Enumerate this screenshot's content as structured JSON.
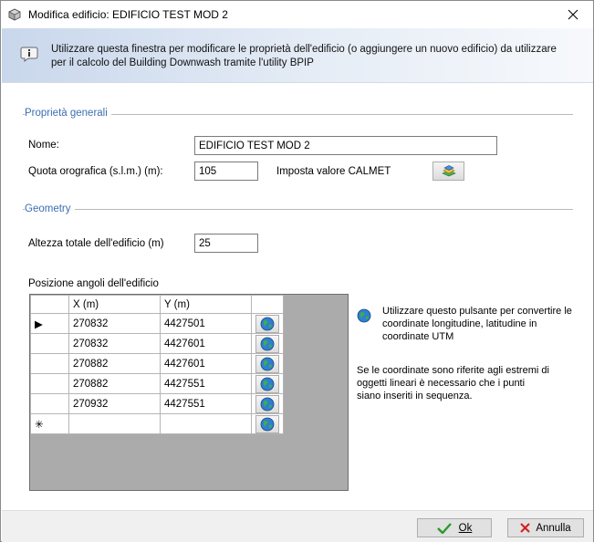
{
  "window": {
    "title": "Modifica edificio: EDIFICIO TEST MOD 2"
  },
  "info": {
    "text": "Utilizzare questa finestra per modificare le proprietà dell'edificio (o aggiungere un nuovo edificio) da utilizzare per il calcolo del Building Downwash tramite l'utility BPIP"
  },
  "general": {
    "section_title": "Proprietà generali",
    "name_label": "Nome:",
    "name_value": "EDIFICIO TEST MOD 2",
    "quota_label": "Quota orografica (s.l.m.)  (m):",
    "quota_value": "105",
    "calmet_label": "Imposta valore CALMET"
  },
  "geometry": {
    "section_title": "Geometry",
    "height_label": "Altezza totale dell'edificio (m)",
    "height_value": "25",
    "corners_label": "Posizione angoli dell'edificio"
  },
  "grid": {
    "col_x": "X (m)",
    "col_y": "Y (m)",
    "rows": [
      {
        "marker": "▶",
        "x": "270832",
        "y": "4427501"
      },
      {
        "marker": "",
        "x": "270832",
        "y": "4427601"
      },
      {
        "marker": "",
        "x": "270882",
        "y": "4427601"
      },
      {
        "marker": "",
        "x": "270882",
        "y": "4427551"
      },
      {
        "marker": "",
        "x": "270932",
        "y": "4427551"
      }
    ],
    "new_row_marker": "✳"
  },
  "side": {
    "convert_text_1": "Utilizzare questo pulsante per convertire le",
    "convert_text_2": "coordinate longitudine, latitudine in",
    "convert_text_3": "coordinate UTM",
    "note_1": "Se le coordinate sono riferite agli estremi di",
    "note_2": "oggetti lineari è necessario che i punti",
    "note_3": "siano inseriti in sequenza."
  },
  "footer": {
    "ok_label": "Ok",
    "cancel_label": "Annulla"
  },
  "icons": {
    "title": "building-icon",
    "info": "info-icon",
    "globe": "globe-icon",
    "ok": "check-icon",
    "cancel": "x-icon"
  },
  "colors": {
    "accent": "#3c6fb0",
    "selection": "#0078d7",
    "grid_background": "#ababab",
    "ok_check": "#2a9a2a",
    "cancel_x": "#d02020"
  }
}
